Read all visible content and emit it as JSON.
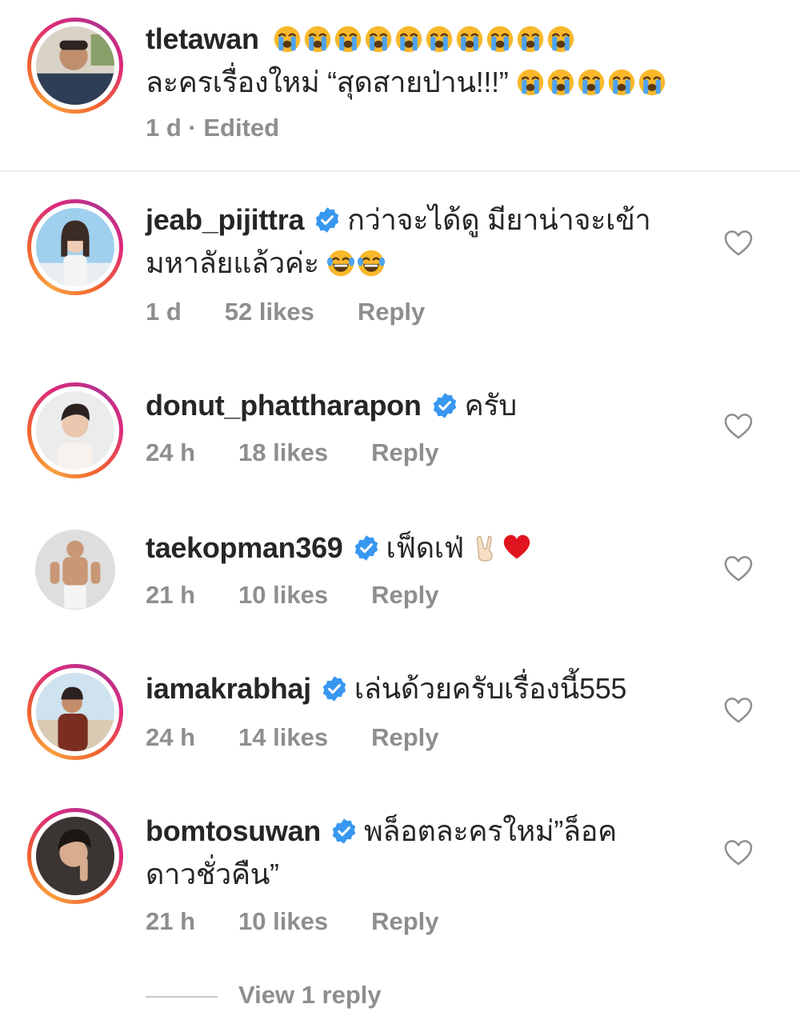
{
  "caption": {
    "username": "tletawan",
    "line1_emoji_count": 10,
    "line2_text": "ละครเรื่องใหม่ “สุดสายป่าน!!!”",
    "line2_emoji_count": 5,
    "meta": "1 d · Edited"
  },
  "comments": [
    {
      "username": "jeab_pijittra",
      "verified": true,
      "text_line1": "กว่าจะได้ดู มียาน่าจะเข้า",
      "text_line2": "มหาลัยแล้วค่ะ",
      "emoji": "joy-emoji",
      "time": "1 d",
      "likes": "52 likes",
      "reply": "Reply"
    },
    {
      "username": "donut_phattharapon",
      "verified": true,
      "text_line1": "ครับ",
      "time": "24 h",
      "likes": "18 likes",
      "reply": "Reply"
    },
    {
      "username": "taekopman369",
      "verified": true,
      "text_line1": "เฟ็ดเฟ่",
      "emoji": "victory-hand-emoji, red-heart-emoji",
      "time": "21 h",
      "likes": "10 likes",
      "reply": "Reply"
    },
    {
      "username": "iamakrabhaj",
      "verified": true,
      "text_line1": "เล่นด้วยครับเรื่องนี้555",
      "time": "24 h",
      "likes": "14 likes",
      "reply": "Reply"
    },
    {
      "username": "bomtosuwan",
      "verified": true,
      "text_line1": "พล็อตละครใหม่”ล็อค",
      "text_line2": "ดาวชั่วคืน”",
      "time": "21 h",
      "likes": "10 likes",
      "reply": "Reply"
    }
  ],
  "view_replies": "View 1 reply",
  "colors": {
    "text": "#262626",
    "meta": "#8e8e8e",
    "verified": "#3897f0",
    "heart_outline": "#8e8e8e",
    "divider": "#ececec"
  }
}
